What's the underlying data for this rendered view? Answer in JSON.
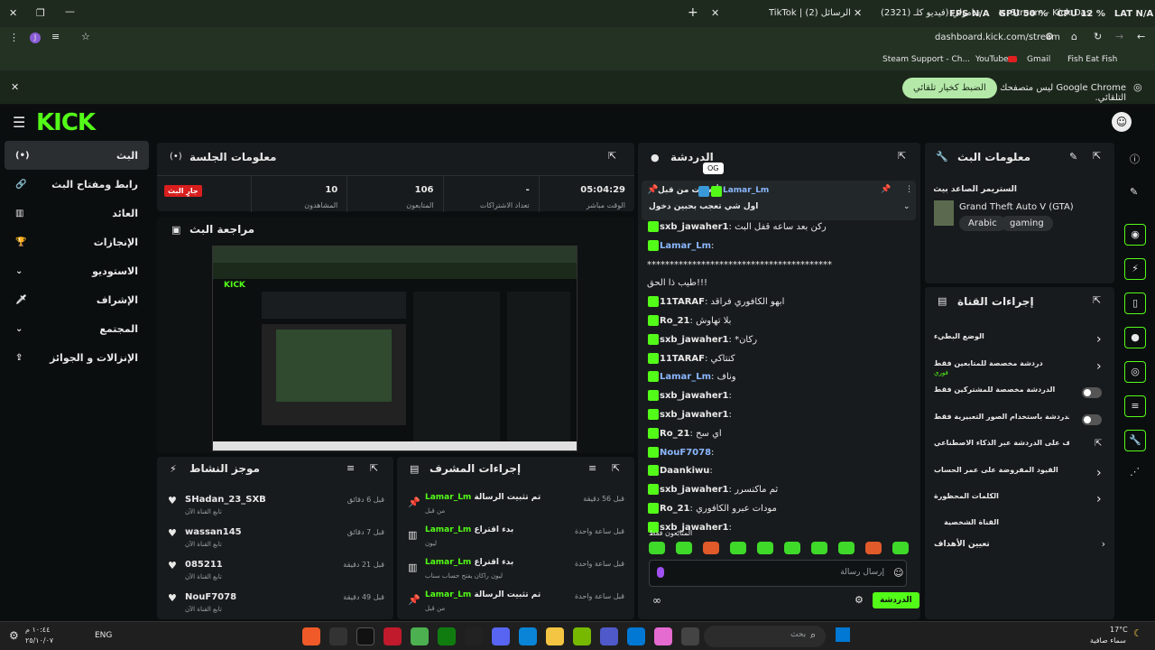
{
  "browser": {
    "tabs": [
      {
        "label": "Stream - Kick Dashboard"
      },
      {
        "label": "(2321) دابلر - صامولي (فيديو كلـ"
      },
      {
        "label": "TikTok | الرسائل (2)"
      }
    ],
    "perf": {
      "fps": "FPS N/A",
      "gpu": "GPU 50 %",
      "cpu": "CPU 12 %",
      "lat": "LAT N/A"
    },
    "url": "dashboard.kick.com/stream",
    "bookmarks": [
      "Steam Support - Ch...",
      "YouTube",
      "Gmail",
      "Fish Eat Fish"
    ],
    "infobar": {
      "message": "Google Chrome ليس متصفحك التلقائي.",
      "button": "الضبط كخيار تلقائي"
    },
    "profile_initial": "J"
  },
  "sidebar": {
    "items": [
      {
        "label": "البث",
        "icon": "broadcast-icon",
        "active": true
      },
      {
        "label": "رابط ومفتاح البث",
        "icon": "link-icon"
      },
      {
        "label": "العائد",
        "icon": "chart-icon"
      },
      {
        "label": "الإنجازات",
        "icon": "trophy-icon"
      },
      {
        "label": "الاستوديو",
        "icon": "studio-icon"
      },
      {
        "label": "الإشراف",
        "icon": "sword-icon"
      },
      {
        "label": "المجتمع",
        "icon": "community-icon"
      },
      {
        "label": "الإنزالات و الجوائز",
        "icon": "drops-icon"
      }
    ]
  },
  "session": {
    "title": "معلومات الجلسة",
    "live_badge": "جارٍ البث",
    "stats": [
      {
        "value": "05:04:29",
        "label": "الوقت مباشر"
      },
      {
        "value": "-",
        "label": "تعداد الاشتراكات"
      },
      {
        "value": "106",
        "label": "المتابعون"
      },
      {
        "value": "10",
        "label": "المشاهدون"
      }
    ]
  },
  "preview": {
    "title": "مراجعة البث"
  },
  "activity": {
    "title": "موجز النشاط",
    "items": [
      {
        "user": "SHadan_23_SXB",
        "action": "تابع القناة الآن",
        "time": "قبل 6 دقائق"
      },
      {
        "user": "wassan145",
        "action": "تابع القناة الآن",
        "time": "قبل 7 دقائق"
      },
      {
        "user": "085211",
        "action": "تابع القناة الآن",
        "time": "قبل 21 دقيقة"
      },
      {
        "user": "NouF7078",
        "action": "تابع القناة الآن",
        "time": "قبل 49 دقيقة"
      }
    ]
  },
  "modactions": {
    "title": "إجراءات المشرف",
    "items": [
      {
        "title": "تم تثبيت الرسالة",
        "sub": "من قبل",
        "user": "Lamar_Lm",
        "time": "قبل 56 دقيقة",
        "icon": "pin-icon"
      },
      {
        "title": "بدء اقتراع",
        "sub": "ليون",
        "user": "Lamar_Lm",
        "time": "قبل ساعة واحدة",
        "icon": "poll-icon"
      },
      {
        "title": "بدء اقتراع",
        "sub": "ليون راكان يفتح حساب سناب",
        "user": "Lamar_Lm",
        "time": "قبل ساعة واحدة",
        "icon": "poll-icon"
      },
      {
        "title": "تم تثبيت الرسالة",
        "sub": "من قبل",
        "user": "Lamar_Lm",
        "time": "قبل ساعة واحدة",
        "icon": "pin-icon"
      }
    ]
  },
  "chat": {
    "title": "الدردشة",
    "og": "OG",
    "pinned": {
      "label": "أرسلت من قبل",
      "user": "Lamar_Lm",
      "text": "اول شي تعجب بحبين دخول"
    },
    "messages": [
      {
        "user": "sxb_jawaher1",
        "text": "ركن بعد ساعه قفل البث",
        "color": "#e8e8e8"
      },
      {
        "user": "Lamar_Lm",
        "text": "",
        "color": "#8bb7ff"
      },
      {
        "user": "",
        "text": "*****************************************",
        "color": "#e8e8e8"
      },
      {
        "user": "",
        "text": "!!!طيب ذا الحق",
        "color": "#e8e8e8"
      },
      {
        "user": "11TARAF",
        "text": "ابهو الكافوري فراقد",
        "color": "#e8e8e8"
      },
      {
        "user": "Ro_21",
        "text": "بلا تهاوش",
        "color": "#e8e8e8"
      },
      {
        "user": "sxb_jawaher1",
        "text": "*ركان",
        "color": "#e8e8e8"
      },
      {
        "user": "11TARAF",
        "text": "كنتاكي",
        "color": "#e8e8e8"
      },
      {
        "user": "Lamar_Lm",
        "text": "وناف",
        "color": "#8bb7ff"
      },
      {
        "user": "sxb_jawaher1",
        "text": "",
        "color": "#e8e8e8"
      },
      {
        "user": "sxb_jawaher1",
        "text": "",
        "color": "#e8e8e8"
      },
      {
        "user": "Ro_21",
        "text": "اي سح",
        "color": "#e8e8e8"
      },
      {
        "user": "NouF7078",
        "text": "",
        "color": "#8bb7ff"
      },
      {
        "user": "Daankiwu",
        "text": "",
        "color": "#e8e8e8"
      },
      {
        "user": "sxb_jawaher1",
        "text": "ثم ماكنسرر",
        "color": "#e8e8e8"
      },
      {
        "user": "Ro_21",
        "text": "مودات عبرو الكافوري",
        "color": "#e8e8e8"
      },
      {
        "user": "sxb_jawaher1",
        "text": "",
        "color": "#e8e8e8"
      }
    ],
    "followers_only": "المتابعون فقط",
    "placeholder": "إرسال رسالة",
    "send": "الدردشة"
  },
  "streaminfo": {
    "title": "معلومات البث",
    "stream_title": "الستريمر الصاعد بيث حياكم الله",
    "game": "Grand Theft Auto V (GTA)",
    "tags": [
      "Arabic",
      "gaming"
    ]
  },
  "channelactions": {
    "title": "إجراءات القناة",
    "items": [
      {
        "label": "الوضع البطيء",
        "control": "chevron"
      },
      {
        "label": "دردشة مخصصة للمتابعين فقط",
        "sub": "فوري",
        "control": "chevron"
      },
      {
        "label": "الدردشة مخصصة للمشتركين فقط",
        "control": "toggle"
      },
      {
        "label": "الدردشة باستخدام الصور التعبيرية فقط",
        "control": "toggle"
      },
      {
        "label": "الإشراف على الدردشة عبر الذكاء الاصطناعي",
        "control": "external"
      },
      {
        "label": "القيود المفروضة على عمر الحساب",
        "control": "chevron"
      },
      {
        "label": "الكلمات المحظورة",
        "control": "chevron"
      }
    ],
    "personal_section": "القناة الشخصية",
    "goals": "تعيين الأهداف"
  },
  "taskbar": {
    "time": "١٠:٤٤ م",
    "date": "٢٥/١٠/٠٧",
    "lang": "ENG",
    "search_placeholder": "بحث",
    "weather_temp": "17°C",
    "weather_desc": "سماء صافية"
  },
  "colors": {
    "brand": "#53fc18",
    "live": "#d91e1e",
    "chrome": "#243224"
  }
}
